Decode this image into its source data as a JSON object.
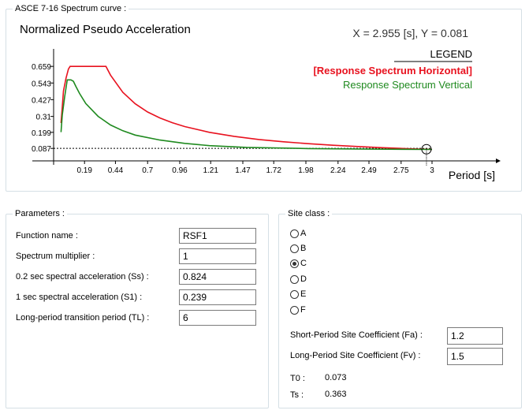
{
  "chart_panel": {
    "group_title": "ASCE 7-16 Spectrum curve :",
    "y_title": "Normalized Pseudo Acceleration",
    "readout": "X = 2.955 [s],  Y = 0.081",
    "x_title": "Period [s]",
    "legend_title": "LEGEND"
  },
  "chart_data": {
    "type": "line",
    "xlabel": "Period [s]",
    "ylabel": "Normalized Pseudo Acceleration",
    "xlim": [
      -0.06,
      3.0
    ],
    "ylim": [
      0.0,
      0.77
    ],
    "x_ticks": [
      "0.19",
      "0.44",
      "0.7",
      "0.96",
      "1.21",
      "1.47",
      "1.72",
      "1.98",
      "2.24",
      "2.49",
      "2.75",
      "3"
    ],
    "y_ticks": [
      "0.659",
      "0.543",
      "0.427",
      "0.31",
      "0.199",
      "0.087"
    ],
    "series": [
      {
        "name": "[Response Spectrum Horizontal]",
        "color": "#e8121f",
        "x": [
          0.0,
          0.01,
          0.02,
          0.04,
          0.06,
          0.073,
          0.1,
          0.15,
          0.2,
          0.25,
          0.3,
          0.363,
          0.4,
          0.5,
          0.6,
          0.7,
          0.8,
          0.9,
          1.0,
          1.2,
          1.4,
          1.6,
          1.8,
          2.0,
          2.2,
          2.4,
          2.6,
          2.8,
          3.0
        ],
        "y": [
          0.264,
          0.376,
          0.488,
          0.576,
          0.64,
          0.659,
          0.659,
          0.659,
          0.659,
          0.659,
          0.659,
          0.659,
          0.598,
          0.478,
          0.398,
          0.341,
          0.299,
          0.266,
          0.239,
          0.199,
          0.171,
          0.149,
          0.133,
          0.12,
          0.109,
          0.1,
          0.092,
          0.085,
          0.08
        ]
      },
      {
        "name": "Response Spectrum Vertical",
        "color": "#1f8a1f",
        "x": [
          0.0,
          0.01,
          0.03,
          0.05,
          0.08,
          0.1,
          0.12,
          0.15,
          0.2,
          0.3,
          0.4,
          0.5,
          0.6,
          0.8,
          1.0,
          1.2,
          1.5,
          2.0,
          2.5,
          3.0
        ],
        "y": [
          0.2,
          0.32,
          0.45,
          0.565,
          0.565,
          0.555,
          0.52,
          0.47,
          0.4,
          0.31,
          0.25,
          0.21,
          0.18,
          0.145,
          0.122,
          0.106,
          0.094,
          0.086,
          0.082,
          0.08
        ]
      }
    ],
    "reference_line": {
      "y": 0.087,
      "style": "dotted",
      "color": "#000000"
    },
    "cursor_marker": {
      "x": 2.955,
      "y": 0.081
    },
    "legend": {
      "title": "LEGEND",
      "position": "top-right"
    }
  },
  "parameters": {
    "group_title": "Parameters :",
    "fields": [
      {
        "label": "Function name :",
        "value": "RSF1"
      },
      {
        "label": "Spectrum multiplier :",
        "value": "1"
      },
      {
        "label": "0.2 sec spectral acceleration (Ss) :",
        "value": "0.824"
      },
      {
        "label": "1 sec spectral acceleration (S1) :",
        "value": "0.239"
      },
      {
        "label": "Long-period transition period (TL) :",
        "value": "6"
      }
    ]
  },
  "site_class": {
    "group_title": "Site class :",
    "options": [
      "A",
      "B",
      "C",
      "D",
      "E",
      "F"
    ],
    "selected": "C",
    "fa_label": "Short-Period Site Coefficient (Fa) :",
    "fa_value": "1.2",
    "fv_label": "Long-Period Site Coefficient (Fv) :",
    "fv_value": "1.5",
    "t0_label": "T0 :",
    "t0_value": "0.073",
    "ts_label": "Ts :",
    "ts_value": "0.363"
  }
}
